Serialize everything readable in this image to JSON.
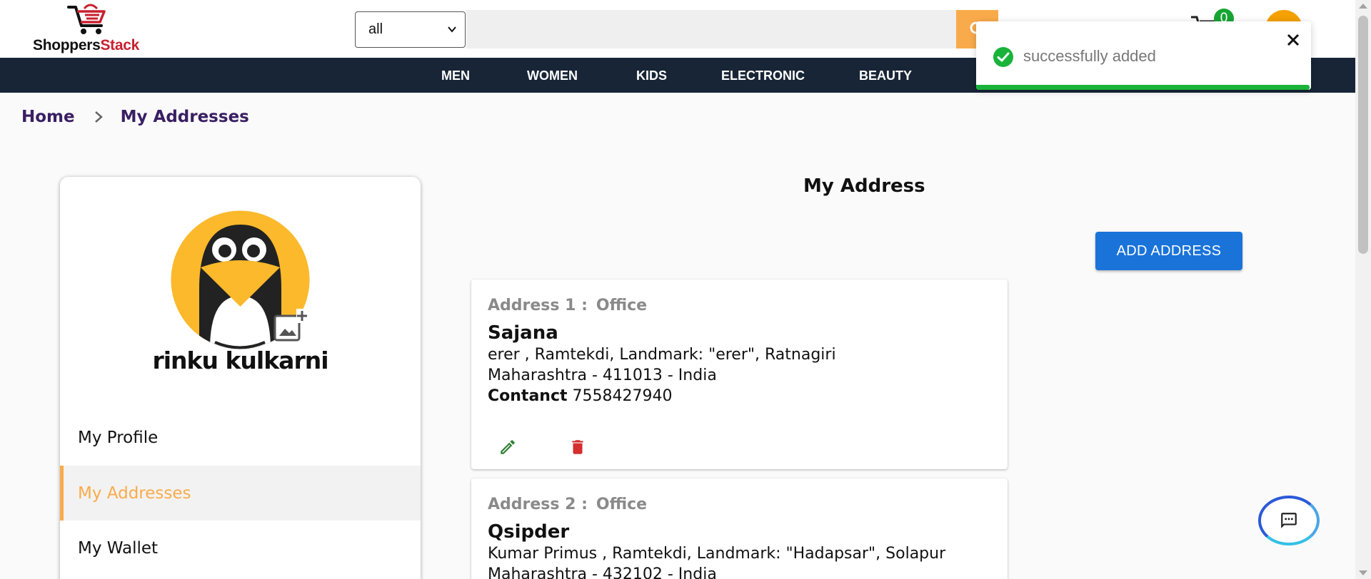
{
  "header": {
    "logo": {
      "part1": "Shoppers",
      "part2": "Stack"
    },
    "category_select": {
      "value": "all"
    },
    "search": {
      "placeholder": ""
    },
    "cart_count": "0"
  },
  "nav": {
    "items": [
      "MEN",
      "WOMEN",
      "KIDS",
      "ELECTRONIC",
      "BEAUTY"
    ]
  },
  "toast": {
    "message": "successfully added",
    "progress": 0.995
  },
  "breadcrumb": {
    "home": "Home",
    "current": "My Addresses"
  },
  "sidebar": {
    "name": "rinku kulkarni",
    "items": [
      "My Profile",
      "My Addresses",
      "My Wallet"
    ],
    "active": "My Addresses"
  },
  "main": {
    "title": "My Address",
    "add_button": "ADD ADDRESS",
    "addresses": [
      {
        "label": "Address 1 :",
        "type": "Office",
        "name": "Sajana",
        "line1": "erer , Ramtekdi, Landmark: \"erer\", Ratnagiri",
        "line2": "Maharashtra - 411013 - India",
        "contact_label": "Contanct",
        "contact": "7558427940"
      },
      {
        "label": "Address 2 :",
        "type": "Office",
        "name": "Qsipder",
        "line1": "Kumar Primus , Ramtekdi, Landmark: \"Hadapsar\", Solapur",
        "line2": "Maharashtra - 432102 - India"
      }
    ]
  },
  "colors": {
    "accent": "#f9ab4b",
    "navbar": "#172536",
    "primary_button": "#1a73d9",
    "success": "#19b33a",
    "delete": "#d32f2f",
    "edit": "#2e7d32",
    "breadcrumb": "#3a1f63"
  }
}
